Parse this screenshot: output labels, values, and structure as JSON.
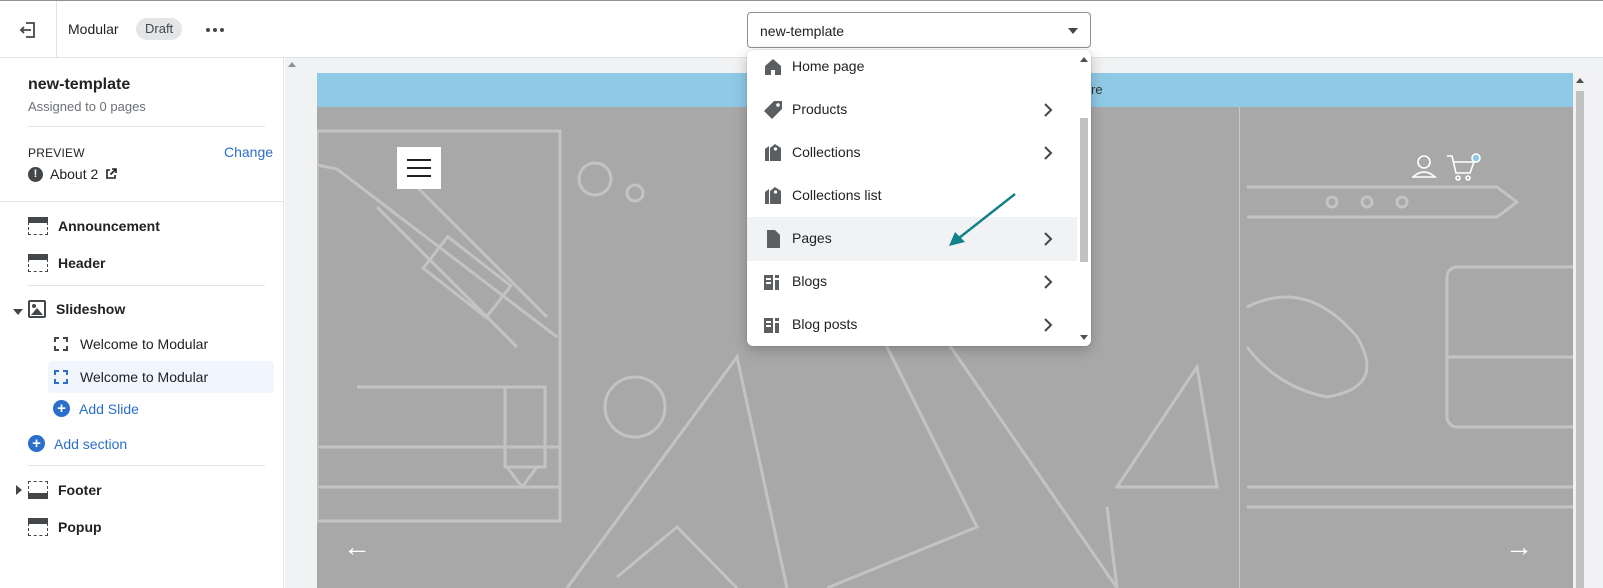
{
  "topbar": {
    "exit_icon": "exit-icon",
    "theme_name": "Modular",
    "status_badge": "Draft",
    "more_icon": "more-horizontal-icon",
    "template_select_value": "new-template"
  },
  "sidebar": {
    "title": "new-template",
    "subtitle": "Assigned to 0 pages",
    "preview_label": "PREVIEW",
    "change_label": "Change",
    "preview_value": "About 2",
    "preview_warning_glyph": "!",
    "sections": {
      "announcement": "Announcement",
      "header": "Header",
      "slideshow": "Slideshow",
      "slides": [
        "Welcome to Modular",
        "Welcome to Modular"
      ],
      "add_slide": "Add Slide",
      "add_section": "Add section",
      "footer": "Footer",
      "popup": "Popup"
    }
  },
  "preview": {
    "announcement_text": "re",
    "prev_arrow": "←",
    "next_arrow": "→",
    "accent_color": "#8ecae6"
  },
  "dropdown": {
    "items": [
      {
        "label": "Home page",
        "icon": "home-icon",
        "has_submenu": false
      },
      {
        "label": "Products",
        "icon": "tag-icon",
        "has_submenu": true
      },
      {
        "label": "Collections",
        "icon": "collections-icon",
        "has_submenu": true
      },
      {
        "label": "Collections list",
        "icon": "collections-list-icon",
        "has_submenu": false
      },
      {
        "label": "Pages",
        "icon": "page-icon",
        "has_submenu": true
      },
      {
        "label": "Blogs",
        "icon": "blog-icon",
        "has_submenu": true
      },
      {
        "label": "Blog posts",
        "icon": "blog-post-icon",
        "has_submenu": true
      }
    ],
    "hovered": "Pages"
  },
  "colors": {
    "link": "#2c6ecb",
    "annotation_arrow": "#13808a"
  }
}
